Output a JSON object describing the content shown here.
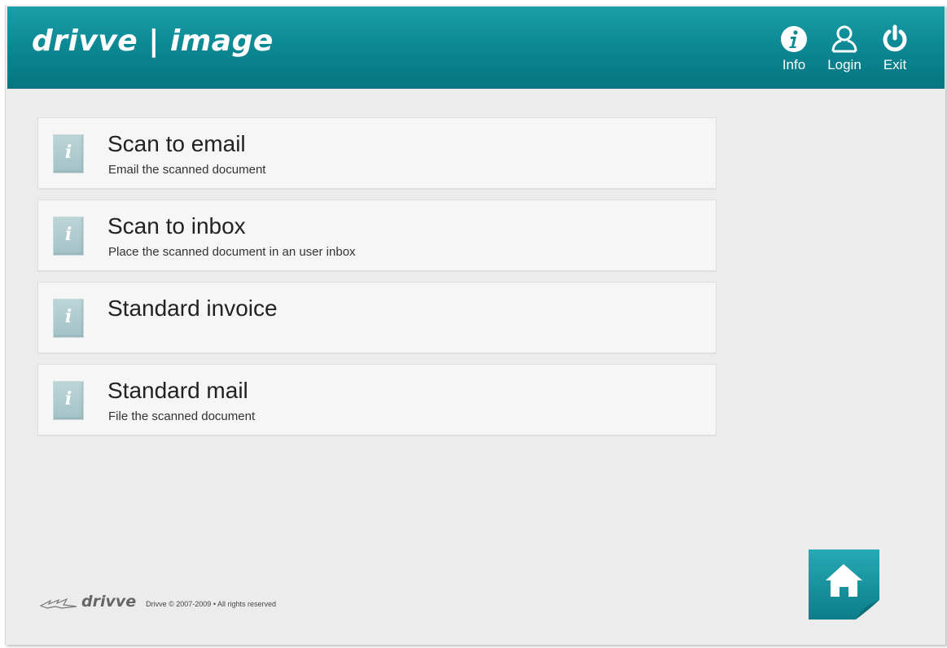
{
  "header": {
    "logo": "drivve | image",
    "nav": [
      {
        "label": "Info",
        "icon": "info-icon"
      },
      {
        "label": "Login",
        "icon": "user-icon"
      },
      {
        "label": "Exit",
        "icon": "power-icon"
      }
    ]
  },
  "tiles": [
    {
      "title": "Scan to email",
      "subtitle": "Email the scanned document",
      "icon": "info-icon"
    },
    {
      "title": "Scan to inbox",
      "subtitle": "Place the scanned document in an user inbox",
      "icon": "info-icon"
    },
    {
      "title": "Standard invoice",
      "subtitle": "",
      "icon": "info-icon"
    },
    {
      "title": "Standard mail",
      "subtitle": "File the scanned document",
      "icon": "info-icon"
    }
  ],
  "footer": {
    "brand": "drivve",
    "copyright": "Drivve © 2007-2009 • All rights reserved"
  },
  "home": {
    "icon": "home-icon"
  },
  "colors": {
    "header": "#0d8a95",
    "background": "#ececec",
    "tile": "#f6f6f6",
    "home_button": "#1a96a4"
  }
}
